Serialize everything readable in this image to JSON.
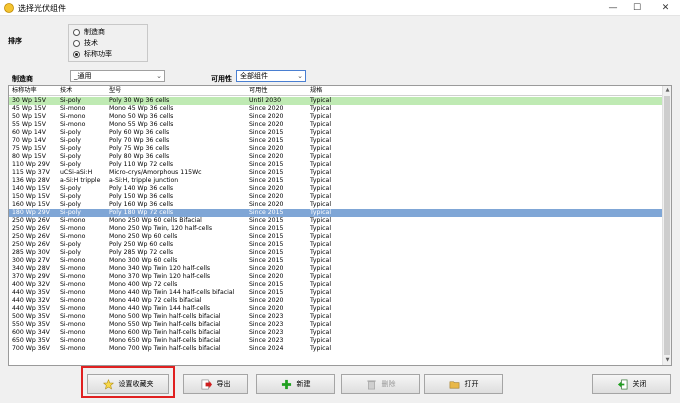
{
  "window": {
    "title": "选择光伏组件",
    "min_glyph": "—",
    "max_glyph": "☐",
    "close_glyph": "✕"
  },
  "sort": {
    "label": "排序",
    "options": [
      {
        "label": "制造商",
        "selected": false
      },
      {
        "label": "技术",
        "selected": false
      },
      {
        "label": "标称功率",
        "selected": true
      }
    ]
  },
  "filters": {
    "manufacturer_label": "制造商",
    "manufacturer_value": "_通用",
    "availability_label": "可用性",
    "availability_value": "全部组件"
  },
  "table": {
    "headers": [
      "标称功率",
      "技术",
      "型号",
      "可用性",
      "规格"
    ],
    "rows": [
      [
        "30 Wp 15V",
        "Si-poly",
        "Poly 30 Wp 36 cells",
        "Until 2030",
        "Typical"
      ],
      [
        "45 Wp 15V",
        "Si-mono",
        "Mono 45 Wp 36 cells",
        "Since 2020",
        "Typical"
      ],
      [
        "50 Wp 15V",
        "Si-mono",
        "Mono 50 Wp 36 cells",
        "Since 2020",
        "Typical"
      ],
      [
        "55 Wp 15V",
        "Si-mono",
        "Mono 55 Wp 36 cells",
        "Since 2020",
        "Typical"
      ],
      [
        "60 Wp 14V",
        "Si-poly",
        "Poly 60 Wp  36 cells",
        "Since 2015",
        "Typical"
      ],
      [
        "70 Wp 14V",
        "Si-poly",
        "Poly 70 Wp 36 cells",
        "Since 2015",
        "Typical"
      ],
      [
        "75 Wp 15V",
        "Si-poly",
        "Poly 75 Wp 36 cells",
        "Since 2020",
        "Typical"
      ],
      [
        "80 Wp 15V",
        "Si-poly",
        "Poly 80 Wp 36 cells",
        "Since 2020",
        "Typical"
      ],
      [
        "110 Wp 29V",
        "Si-poly",
        "Poly 110 Wp  72 cells",
        "Since 2015",
        "Typical"
      ],
      [
        "115 Wp 37V",
        "uCSi-aSi:H",
        "Micro-crys/Amorphous 115Wc",
        "Since 2015",
        "Typical"
      ],
      [
        "136 Wp 28V",
        "a-Si:H tripple",
        "a-Si:H, tripple junction",
        "Since 2015",
        "Typical"
      ],
      [
        "140 Wp 15V",
        "Si-poly",
        "Poly 140 Wp 36 cells",
        "Since 2020",
        "Typical"
      ],
      [
        "150 Wp 15V",
        "Si-poly",
        "Poly 150 Wp 36 cells",
        "Since 2020",
        "Typical"
      ],
      [
        "160 Wp 15V",
        "Si-poly",
        "Poly 160 Wp 36 cells",
        "Since 2020",
        "Typical"
      ],
      [
        "180 Wp 29V",
        "Si-poly",
        "Poly 180 Wp  72 cells",
        "Since 2015",
        "Typical"
      ],
      [
        "250 Wp 26V",
        "Si-mono",
        "Mono 250 Wp  60 cells Bifacial",
        "Since 2015",
        "Typical"
      ],
      [
        "250 Wp 26V",
        "Si-mono",
        "Mono 250 Wp  Twin, 120 half-cells",
        "Since 2015",
        "Typical"
      ],
      [
        "250 Wp 26V",
        "Si-mono",
        "Mono 250 Wp  60 cells",
        "Since 2015",
        "Typical"
      ],
      [
        "250 Wp 26V",
        "Si-poly",
        "Poly 250 Wp  60 cells",
        "Since 2015",
        "Typical"
      ],
      [
        "285 Wp 30V",
        "Si-poly",
        "Poly 285 Wp  72 cells",
        "Since 2015",
        "Typical"
      ],
      [
        "300 Wp 27V",
        "Si-mono",
        "Mono 300 Wp 60 cells",
        "Since 2015",
        "Typical"
      ],
      [
        "340 Wp 28V",
        "Si-mono",
        "Mono 340 Wp Twin 120 half-cells",
        "Since 2020",
        "Typical"
      ],
      [
        "370 Wp 29V",
        "Si-mono",
        "Mono 370 Wp Twin 120 half-cells",
        "Since 2020",
        "Typical"
      ],
      [
        "400 Wp 32V",
        "Si-mono",
        "Mono 400 Wp 72 cells",
        "Since 2015",
        "Typical"
      ],
      [
        "440 Wp 35V",
        "Si-mono",
        "Mono 440 Wp Twin 144 half-cells bifacial",
        "Since 2015",
        "Typical"
      ],
      [
        "440 Wp 32V",
        "Si-mono",
        "Mono 440 Wp 72 cells bifacial",
        "Since 2020",
        "Typical"
      ],
      [
        "440 Wp 35V",
        "Si-mono",
        "Mono 440 Wp Twin 144 half-cells",
        "Since 2020",
        "Typical"
      ],
      [
        "500 Wp 35V",
        "Si-mono",
        "Mono 500 Wp Twin half-cells bifacial",
        "Since 2023",
        "Typical"
      ],
      [
        "550 Wp 35V",
        "Si-mono",
        "Mono 550 Wp Twin half-cells bifacial",
        "Since 2023",
        "Typical"
      ],
      [
        "600 Wp 34V",
        "Si-mono",
        "Mono 600 Wp Twin half-cells bifacial",
        "Since 2023",
        "Typical"
      ],
      [
        "650 Wp 35V",
        "Si-mono",
        "Mono 650 Wp Twin half-cells bifacial",
        "Since 2023",
        "Typical"
      ],
      [
        "700 Wp 36V",
        "Si-mono",
        "Mono 700 Wp Twin half-cells bifacial",
        "Since 2024",
        "Typical"
      ]
    ],
    "highlighted_row": 0,
    "selected_row": 14
  },
  "buttons": {
    "favorites": "设置收藏夹",
    "export": "导出",
    "new": "新建",
    "delete": "删除",
    "open": "打开",
    "close": "关闭"
  },
  "colors": {
    "highlight_row": "#bfeab3",
    "selected_row": "#7fa6d6",
    "annotation_box": "#e02020"
  }
}
